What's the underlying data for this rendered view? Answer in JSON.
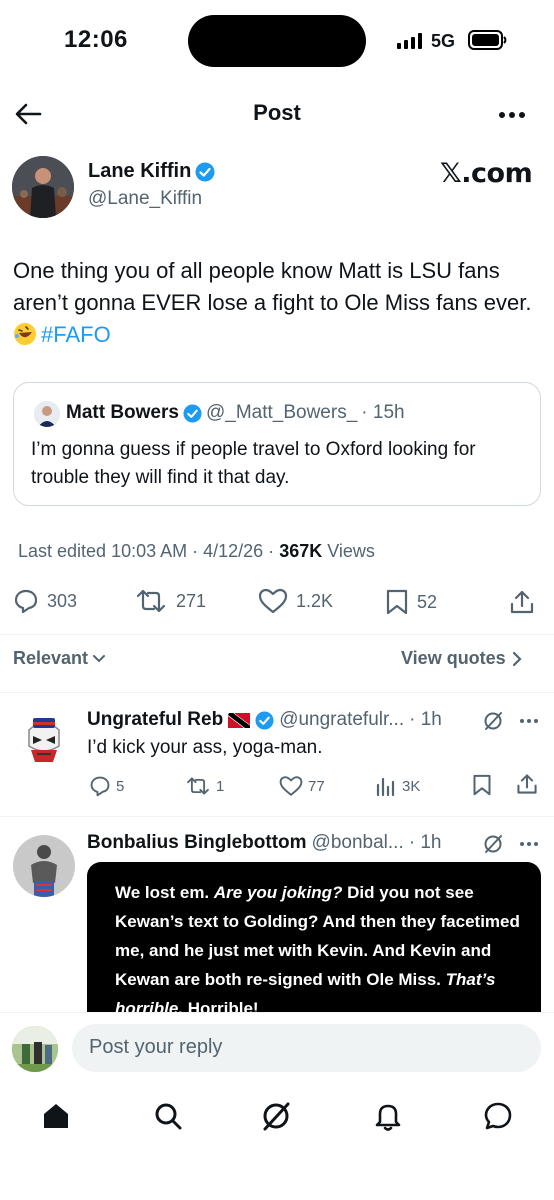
{
  "status_bar": {
    "time": "12:06",
    "network": "5G"
  },
  "nav": {
    "title": "Post"
  },
  "author": {
    "name": "Lane Kiffin",
    "handle": "@Lane_Kiffin",
    "watermark": "𝕏.com"
  },
  "tweet": {
    "text": "One thing you of all people know Matt is LSU fans aren’t gonna EVER lose a fight to Ole Miss fans ever.",
    "hashtag": "#FAFO"
  },
  "quote": {
    "name": "Matt Bowers",
    "handle": "@_Matt_Bowers_",
    "time": "· 15h",
    "text": "I’m gonna guess if people travel to Oxford  looking for trouble they will find it that day."
  },
  "meta": {
    "edited": "Last edited 10:03 AM · 4/12/26 ·",
    "views_count": "367K",
    "views_label": "Views"
  },
  "stats": {
    "replies": "303",
    "reposts": "271",
    "likes": "1.2K",
    "bookmarks": "52"
  },
  "sort": {
    "label": "Relevant",
    "view_quotes": "View quotes"
  },
  "replies": [
    {
      "name": "Ungrateful Reb",
      "handle": "@ungratefulr...",
      "time": "· 1h",
      "text": "I’d kick your ass, yoga-man.",
      "stats": {
        "replies": "5",
        "reposts": "1",
        "likes": "77",
        "views": "3K"
      }
    },
    {
      "name": "Bonbalius Binglebottom",
      "handle": "@bonbal...",
      "time": "· 1h",
      "image_text_1": "We lost em.",
      "image_text_2": "Are you joking?",
      "image_text_3": "Did you not see Kewan’s text to Golding? And then they facetimed me, and he just met with Kevin. And Kevin and Kewan are both re-signed with Ole Miss.",
      "image_text_4": "That’s horrible.",
      "image_text_5": "Horrible!"
    }
  ],
  "composer": {
    "placeholder": "Post your reply"
  },
  "colors": {
    "accent": "#1d9bf0",
    "text": "#0f1419",
    "muted": "#536471",
    "border": "#cfd9de"
  }
}
